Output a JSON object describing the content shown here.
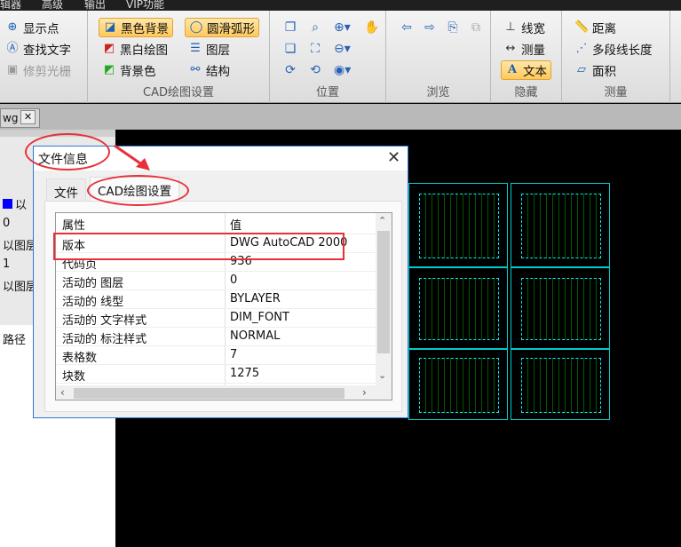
{
  "menu": [
    "辑器",
    "高级",
    "输出",
    "VIP功能"
  ],
  "ribbon": {
    "group1": {
      "items": [
        "显示点",
        "查找文字",
        "修剪光栅"
      ]
    },
    "cad_settings": {
      "label": "CAD绘图设置",
      "items": [
        "黑色背景",
        "圆滑弧形",
        "黑白绘图",
        "图层",
        "背景色",
        "结构"
      ]
    },
    "position": {
      "label": "位置"
    },
    "browse": {
      "label": "浏览"
    },
    "hide": {
      "label": "隐藏",
      "items": [
        "线宽",
        "测量",
        "文本"
      ]
    },
    "measure": {
      "label": "测量",
      "items": [
        "距离",
        "多段线长度",
        "面积"
      ]
    }
  },
  "doc_tab": {
    "label": "wg"
  },
  "left_panel": {
    "rows": [
      "以",
      "0",
      "以图层",
      "1",
      "以图层"
    ],
    "path_label": "路径"
  },
  "dialog": {
    "title": "文件信息",
    "tabs": [
      "文件",
      "CAD绘图设置"
    ],
    "table": {
      "headers": [
        "属性",
        "值"
      ],
      "rows": [
        [
          "版本",
          "DWG AutoCAD 2000"
        ],
        [
          "代码页",
          "936"
        ],
        [
          "活动的 图层",
          "0"
        ],
        [
          "活动的 线型",
          "BYLAYER"
        ],
        [
          "活动的 文字样式",
          "DIM_FONT"
        ],
        [
          "活动的 标注样式",
          "NORMAL"
        ],
        [
          "表格数",
          "7"
        ],
        [
          "块数",
          "1275"
        ]
      ]
    }
  },
  "colors": {
    "accent": "#2b79d6",
    "annotation": "#e8303a",
    "selected": "#ffc95a"
  }
}
